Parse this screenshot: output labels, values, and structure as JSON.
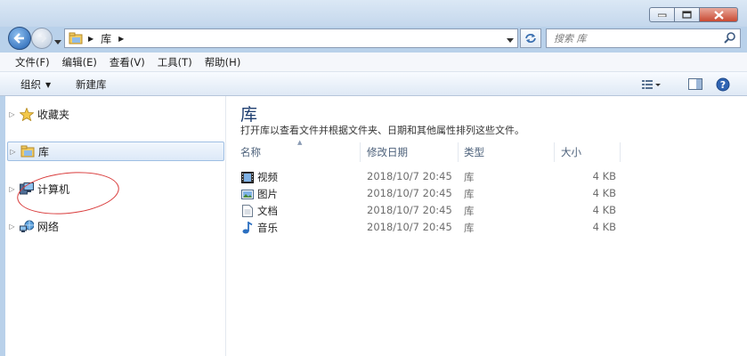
{
  "window": {
    "controls": [
      "minimize-icon",
      "maximize-icon",
      "close-icon"
    ]
  },
  "address": {
    "breadcrumb": "库",
    "search_placeholder": "搜索 库"
  },
  "menu": {
    "items": [
      "文件(F)",
      "编辑(E)",
      "查看(V)",
      "工具(T)",
      "帮助(H)"
    ]
  },
  "toolbar": {
    "organize": "组织",
    "new_library": "新建库"
  },
  "nav": {
    "favorites": "收藏夹",
    "libraries": "库",
    "computer": "计算机",
    "network": "网络"
  },
  "main": {
    "title": "库",
    "description": "打开库以查看文件并根据文件夹、日期和其他属性排列这些文件。",
    "columns": {
      "name": "名称",
      "modified": "修改日期",
      "type": "类型",
      "size": "大小"
    },
    "rows": [
      {
        "icon": "video-library-icon",
        "name": "视频",
        "modified": "2018/10/7 20:45",
        "type": "库",
        "size": "4 KB"
      },
      {
        "icon": "picture-library-icon",
        "name": "图片",
        "modified": "2018/10/7 20:45",
        "type": "库",
        "size": "4 KB"
      },
      {
        "icon": "document-library-icon",
        "name": "文档",
        "modified": "2018/10/7 20:45",
        "type": "库",
        "size": "4 KB"
      },
      {
        "icon": "music-library-icon",
        "name": "音乐",
        "modified": "2018/10/7 20:45",
        "type": "库",
        "size": "4 KB"
      }
    ]
  },
  "annotation": {
    "color": "#d93a3a"
  }
}
